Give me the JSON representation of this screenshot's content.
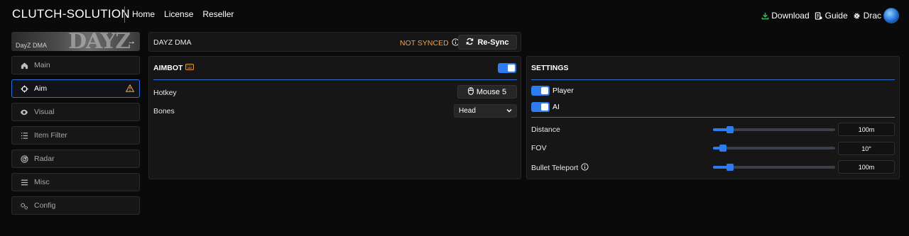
{
  "nav": {
    "brand": "CLUTCH-SOLUTION",
    "links": [
      "Home",
      "License",
      "Reseller"
    ],
    "download": "Download",
    "guide": "Guide",
    "user": "Drac"
  },
  "sidebar": {
    "game_label": "DayZ DMA",
    "game_art_text": "DAYZ",
    "items": [
      {
        "label": "Main",
        "icon": "home-icon"
      },
      {
        "label": "Aim",
        "icon": "crosshair-icon",
        "active": true,
        "warning": true
      },
      {
        "label": "Visual",
        "icon": "eye-icon"
      },
      {
        "label": "Item Filter",
        "icon": "list-icon"
      },
      {
        "label": "Radar",
        "icon": "radar-icon"
      },
      {
        "label": "Misc",
        "icon": "menu-icon"
      },
      {
        "label": "Config",
        "icon": "cogs-icon"
      }
    ]
  },
  "dma": {
    "title": "DAYZ DMA",
    "status": "NOT SYNCED",
    "resync_label": "Re-Sync"
  },
  "aimbot": {
    "title": "AIMBOT",
    "enabled": true,
    "hotkey_label": "Hotkey",
    "hotkey_value": "Mouse 5",
    "bones_label": "Bones",
    "bones_value": "Head"
  },
  "settings": {
    "title": "SETTINGS",
    "player_label": "Player",
    "player_enabled": true,
    "ai_label": "AI",
    "ai_enabled": true,
    "distance_label": "Distance",
    "distance_value": "100m",
    "distance_fraction": 0.11,
    "fov_label": "FOV",
    "fov_value": "10°",
    "fov_fraction": 0.05,
    "bullet_label": "Bullet Teleport",
    "bullet_value": "100m",
    "bullet_fraction": 0.11
  },
  "colors": {
    "accent": "#2f7bf0",
    "warning": "#f0a33c",
    "download_icon": "#2fbf4a"
  }
}
